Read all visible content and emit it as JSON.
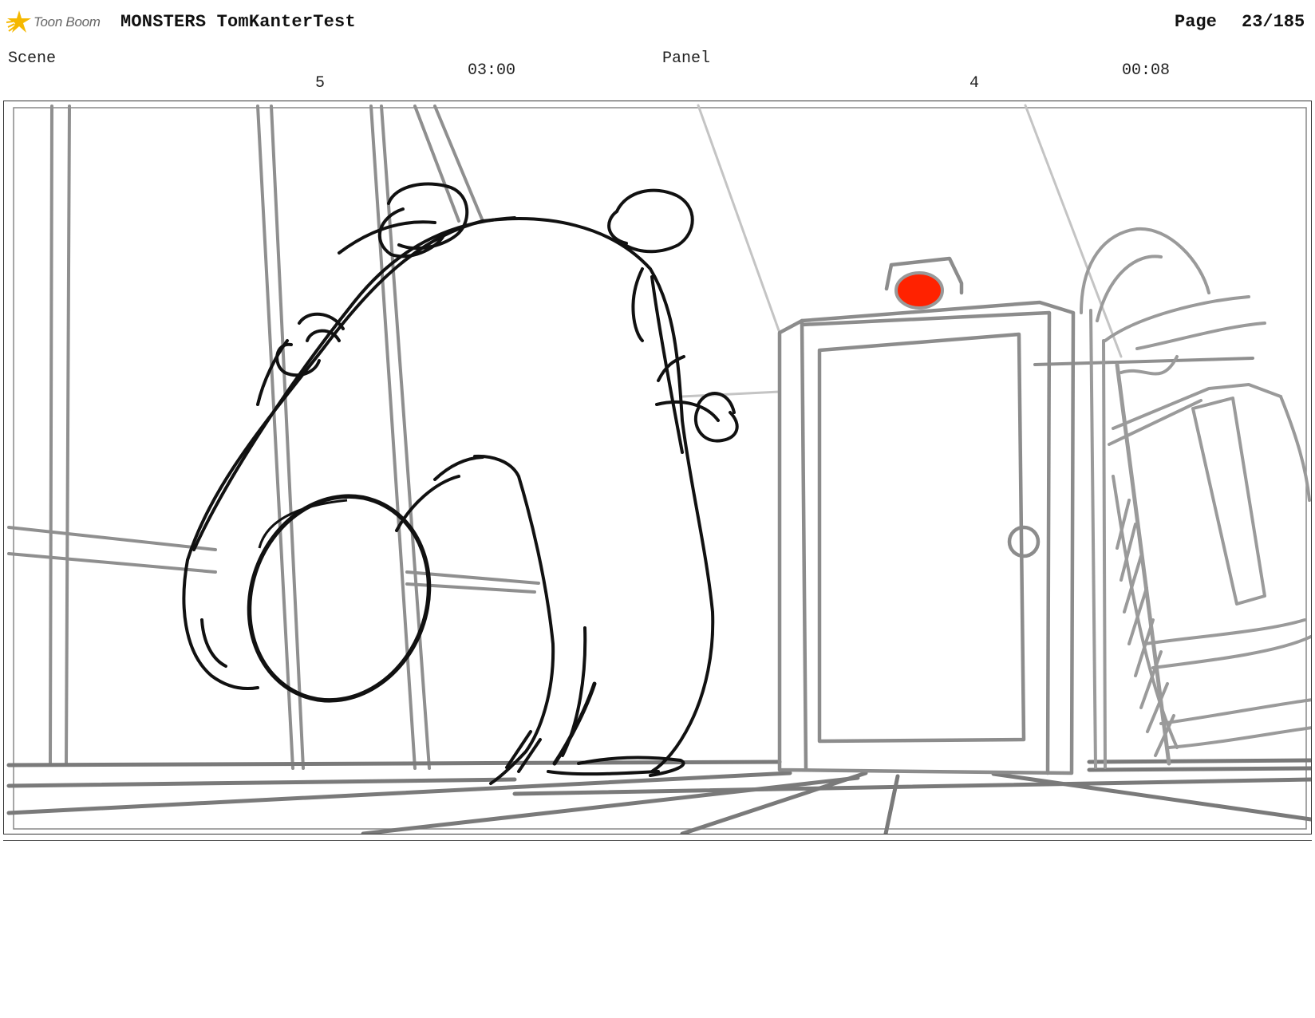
{
  "header": {
    "brand": "Toon Boom",
    "brand_icon": "toon-boom-star-logo",
    "project_title": "MONSTERS TomKanterTest",
    "page_label": "Page",
    "page_number": "23/185"
  },
  "scene": {
    "label": "Scene",
    "number": "5",
    "duration": "03:00"
  },
  "panel": {
    "label": "Panel",
    "number": "4",
    "duration": "00:08"
  },
  "colors": {
    "logo_star": "#f5b800",
    "alarm_light": "#ff2200",
    "sketch_dark": "#111111",
    "sketch_grey": "#999999"
  }
}
